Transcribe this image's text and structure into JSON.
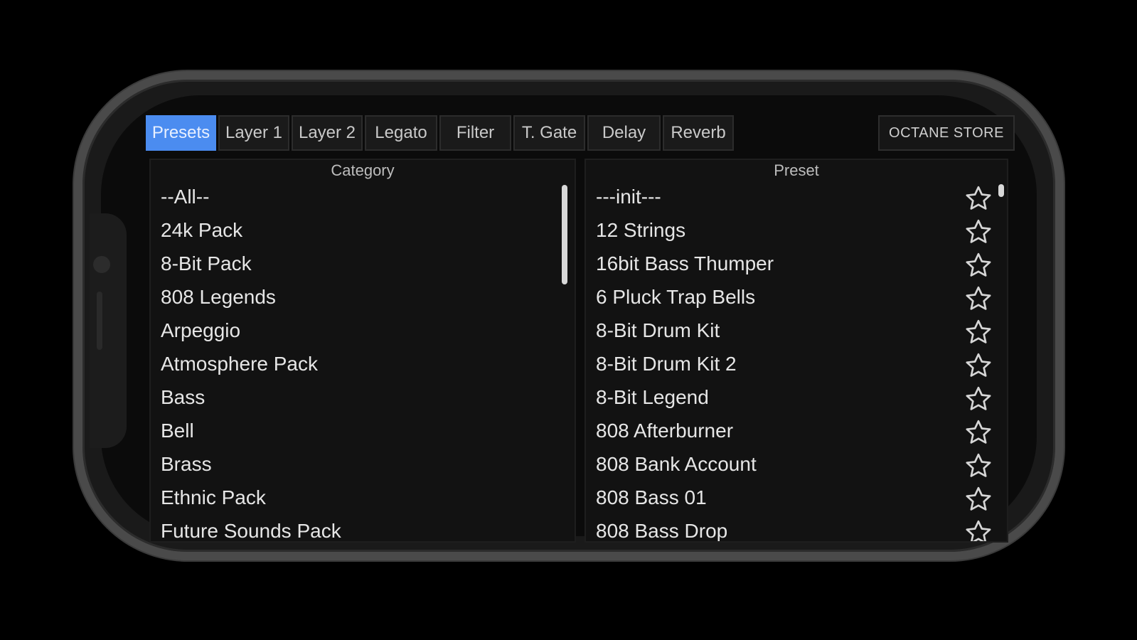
{
  "tabs": [
    {
      "label": "Presets",
      "active": true
    },
    {
      "label": "Layer 1"
    },
    {
      "label": "Layer 2"
    },
    {
      "label": "Legato"
    },
    {
      "label": "Filter"
    },
    {
      "label": "T. Gate"
    },
    {
      "label": "Delay"
    },
    {
      "label": "Reverb"
    }
  ],
  "store_button": "OCTANE STORE",
  "category": {
    "header": "Category",
    "items": [
      "--All--",
      "24k Pack",
      "8-Bit Pack",
      "808 Legends",
      "Arpeggio",
      "Atmosphere Pack",
      "Bass",
      "Bell",
      "Brass",
      "Ethnic Pack",
      "Future Sounds Pack"
    ]
  },
  "preset": {
    "header": "Preset",
    "items": [
      "---init---",
      "12 Strings",
      "16bit Bass Thumper",
      "6 Pluck Trap Bells",
      "8-Bit Drum Kit",
      "8-Bit Drum Kit 2",
      "8-Bit Legend",
      "808 Afterburner",
      "808 Bank Account",
      "808 Bass 01",
      "808 Bass Drop"
    ]
  },
  "icons": {
    "favorite": "star-outline-icon"
  },
  "colors": {
    "accent": "#4b8cf0",
    "background": "#0b0b0b",
    "panel": "#121212",
    "text": "#e6e6e6"
  }
}
